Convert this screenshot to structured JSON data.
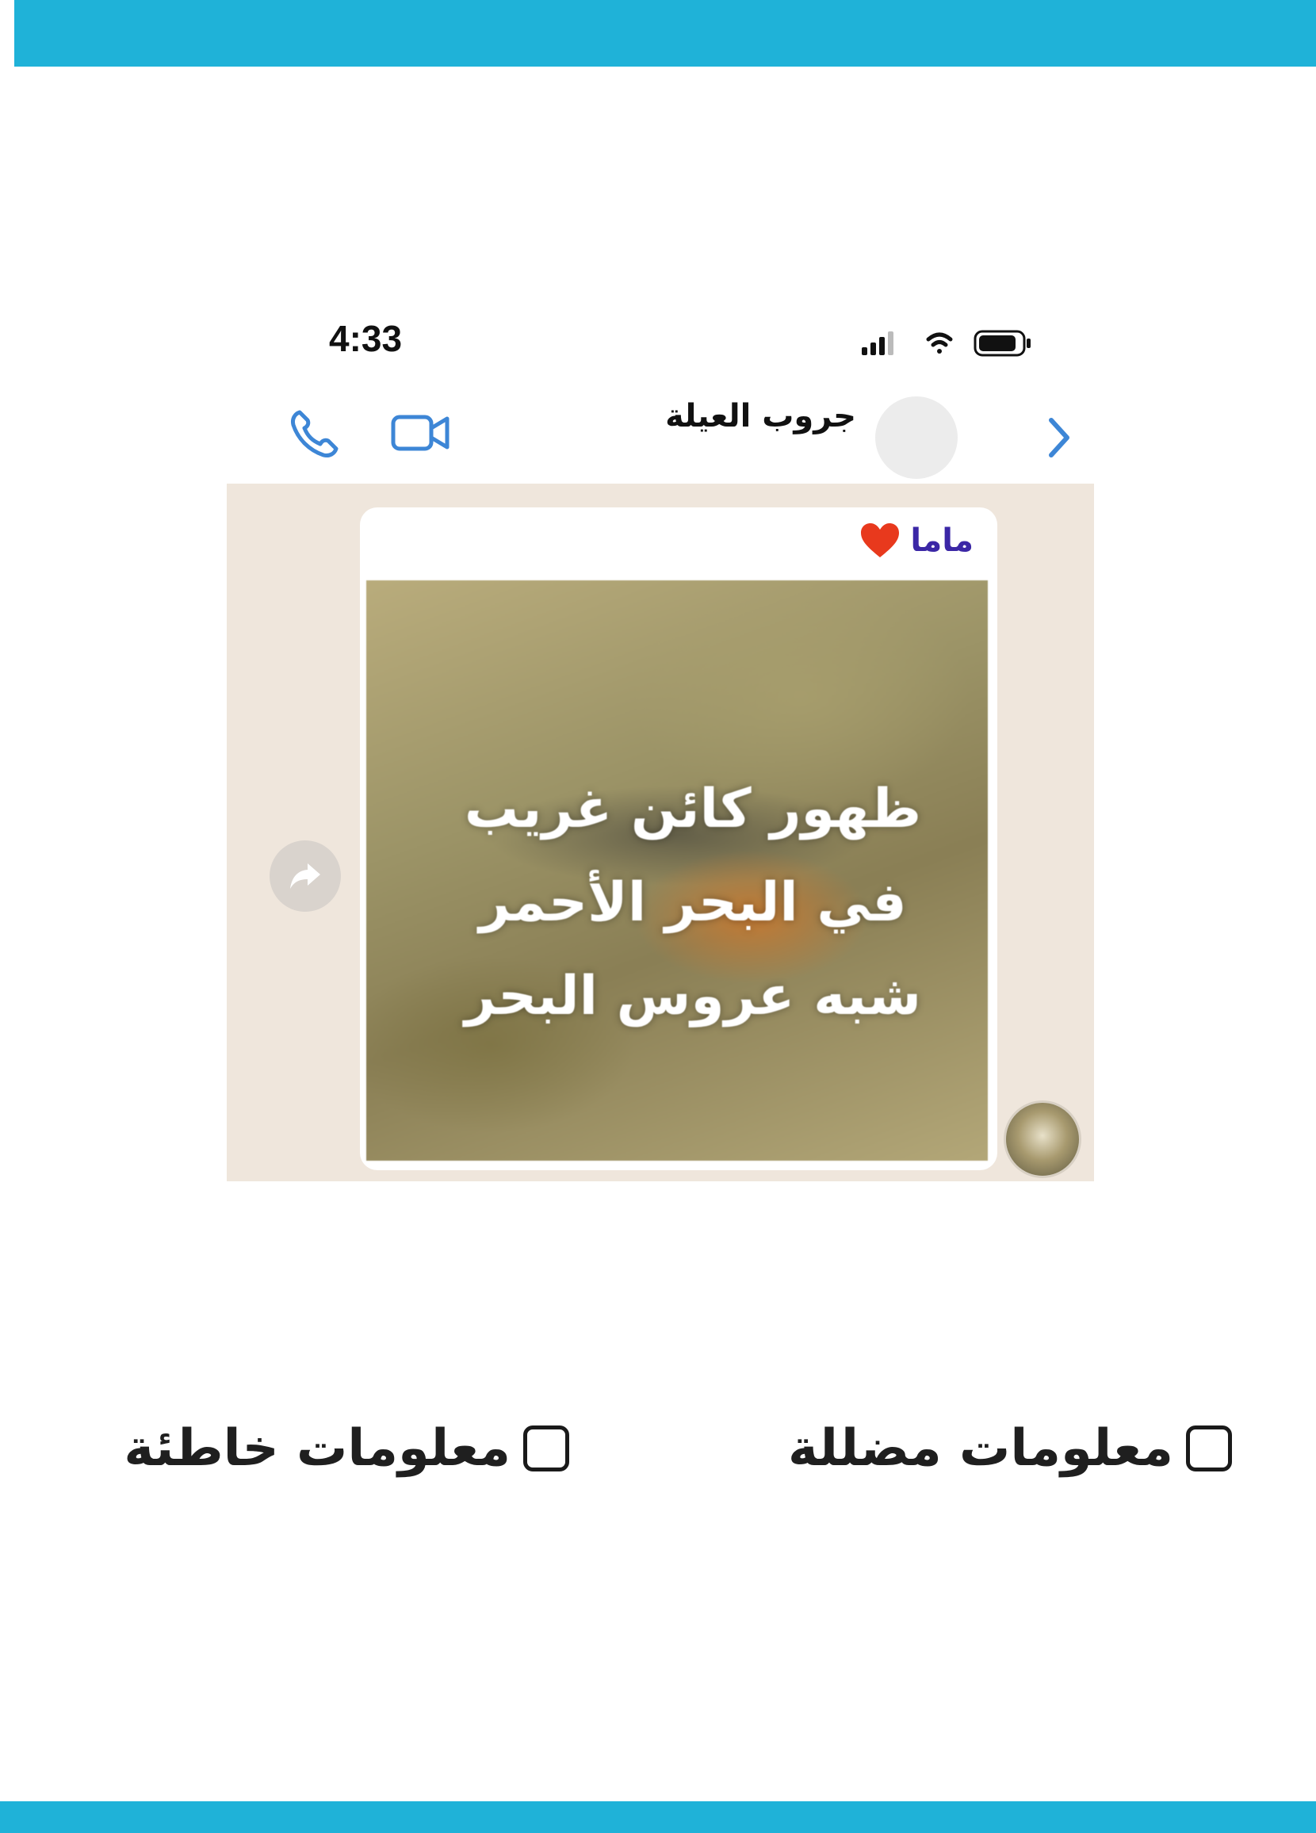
{
  "status_bar": {
    "time": "4:33",
    "icons": [
      "signal-icon",
      "wifi-icon",
      "battery-icon"
    ]
  },
  "chat_header": {
    "title": "جروب العيلة",
    "icons": [
      "back-chevron-icon",
      "video-call-icon",
      "phone-call-icon"
    ]
  },
  "message": {
    "sender_name": "ماما",
    "sender_emoji": "heart-icon",
    "media_text": [
      "ظهور كائن غريب",
      "في البحر الأحمر",
      "شبه عروس البحر"
    ]
  },
  "options": [
    {
      "label": "معلومات مضللة",
      "checked": false
    },
    {
      "label": "معلومات خاطئة",
      "checked": false
    }
  ],
  "colors": {
    "band": "#1fb2d8",
    "accent_blue": "#3d86d6",
    "sender_name": "#3b27a6",
    "chat_background": "#efe6dc"
  }
}
